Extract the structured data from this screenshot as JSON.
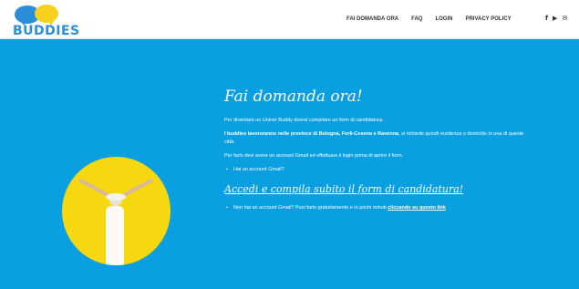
{
  "brand": {
    "logo_text": "BUDDIES"
  },
  "nav": {
    "items": [
      {
        "label": "FAI DOMANDA ORA"
      },
      {
        "label": "FAQ"
      },
      {
        "label": "LOGIN"
      },
      {
        "label": "PRIVACY POLICY"
      }
    ]
  },
  "social": {
    "facebook": "f",
    "youtube": "▶",
    "email": "✉"
  },
  "main": {
    "title": "Fai domanda ora!",
    "p1": "Per diventare un Univer Buddy dovrai compilare un form di candidatura.",
    "p2_strong": "I buddies lavoreranno nelle province di Bologna, Forlì-Cesena e Ravenna",
    "p2_rest": ", si richiede quindi residenza o domicilio in una di queste città.",
    "p3": "Per farlo devi avere un account Gmail ed effettuare il login prima di aprire il form.",
    "bullet1": "Hai un account Gmail?",
    "cta": "Accedi e compila subito il form di candidatura!",
    "bullet2_text": "Non hai un account Gmail? Puoi farlo gratuitamente e in pochi minuti ",
    "bullet2_link": "cliccando su questo link"
  },
  "colors": {
    "accent_blue": "#0a9fe0",
    "brand_yellow": "#f5d80f"
  }
}
